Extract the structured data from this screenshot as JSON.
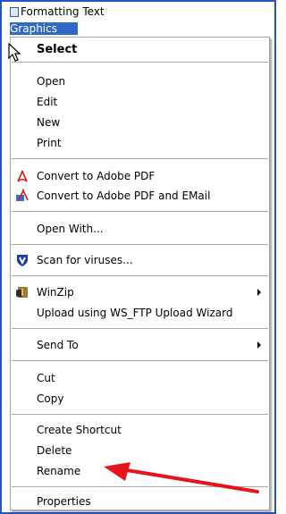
{
  "background_files": [
    {
      "label": "Formatting Text"
    },
    {
      "label": "Graphics"
    }
  ],
  "context_menu": {
    "select_label": "Select",
    "open_label": "Open",
    "edit_label": "Edit",
    "new_label": "New",
    "print_label": "Print",
    "convert_pdf_label": "Convert to Adobe PDF",
    "convert_pdf_email_label": "Convert to Adobe PDF and EMail",
    "open_with_label": "Open With...",
    "scan_label": "Scan for viruses...",
    "winzip_label": "WinZip",
    "upload_label": "Upload using WS_FTP Upload Wizard",
    "send_to_label": "Send To",
    "cut_label": "Cut",
    "copy_label": "Copy",
    "create_shortcut_label": "Create Shortcut",
    "delete_label": "Delete",
    "rename_label": "Rename",
    "properties_label": "Properties"
  },
  "colors": {
    "selection": "#316ac5",
    "frame": "#2453c8",
    "annotation_arrow": "#e8141c",
    "separator": "#aca899"
  },
  "icons": {
    "cursor": "arrow-cursor-icon",
    "pdf": "adobe-pdf-icon",
    "antivirus": "shield-v-icon",
    "winzip": "winzip-icon",
    "submenu": "submenu-arrow-icon"
  }
}
